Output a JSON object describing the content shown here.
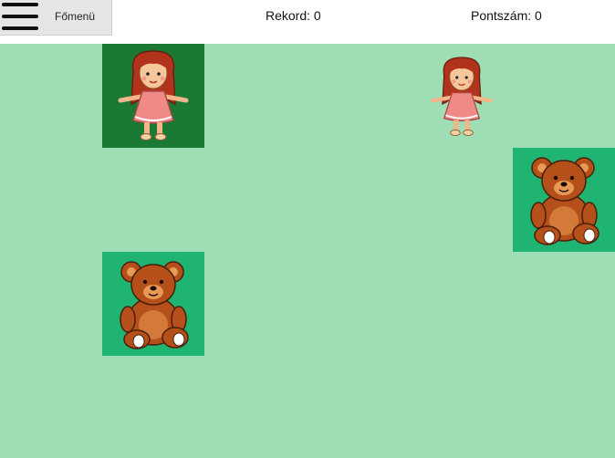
{
  "menu": {
    "label": "Főmenü",
    "icon": "hamburger-menu-icon"
  },
  "stats": {
    "record_label": "Rekord: 0",
    "score_label": "Pontszám: 0"
  },
  "colors": {
    "board": "#9fdeb4",
    "tile_selected": "#1a7a34",
    "tile_highlight": "#20b473"
  },
  "tiles": [
    {
      "item": "doll",
      "icon": "doll-icon",
      "state": "selected"
    },
    {
      "item": "doll",
      "icon": "doll-icon",
      "state": "plain"
    },
    {
      "item": "teddy-bear",
      "icon": "teddy-bear-icon",
      "state": "highlighted"
    },
    {
      "item": "teddy-bear",
      "icon": "teddy-bear-icon",
      "state": "highlighted"
    }
  ]
}
